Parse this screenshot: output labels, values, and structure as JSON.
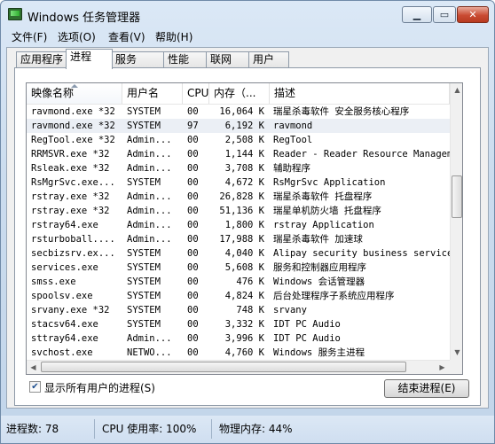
{
  "window": {
    "title": "Windows 任务管理器",
    "minimize_icon": "minimize-icon",
    "maximize_icon": "maximize-icon",
    "close_icon": "close-icon"
  },
  "menu": [
    {
      "label": "文件(F)"
    },
    {
      "label": "选项(O)"
    },
    {
      "label": "查看(V)"
    },
    {
      "label": "帮助(H)"
    }
  ],
  "tabs": [
    {
      "label": "应用程序",
      "active": false
    },
    {
      "label": "进程",
      "active": true
    },
    {
      "label": "服务",
      "active": false
    },
    {
      "label": "性能",
      "active": false
    },
    {
      "label": "联网",
      "active": false
    },
    {
      "label": "用户",
      "active": false
    }
  ],
  "columns": [
    {
      "label": "映像名称",
      "sorted": true
    },
    {
      "label": "用户名",
      "sorted": false
    },
    {
      "label": "CPU",
      "sorted": false
    },
    {
      "label": "内存（...",
      "sorted": false
    },
    {
      "label": "描述",
      "sorted": false
    }
  ],
  "processes": [
    {
      "name": "ravmond.exe *32",
      "user": "SYSTEM",
      "cpu": "00",
      "mem": "16,064 K",
      "desc": "瑞星杀毒软件 安全服务核心程序",
      "selected": false
    },
    {
      "name": "ravmond.exe *32",
      "user": "SYSTEM",
      "cpu": "97",
      "mem": "6,192 K",
      "desc": "ravmond",
      "selected": true
    },
    {
      "name": "RegTool.exe *32",
      "user": "Admin...",
      "cpu": "00",
      "mem": "2,508 K",
      "desc": "RegTool",
      "selected": false
    },
    {
      "name": "RRMSVR.exe *32",
      "user": "Admin...",
      "cpu": "00",
      "mem": "1,144 K",
      "desc": "Reader - Reader Resource Managemer",
      "selected": false
    },
    {
      "name": "Rsleak.exe *32",
      "user": "Admin...",
      "cpu": "00",
      "mem": "3,708 K",
      "desc": "辅助程序",
      "selected": false
    },
    {
      "name": "RsMgrSvc.exe...",
      "user": "SYSTEM",
      "cpu": "00",
      "mem": "4,672 K",
      "desc": "RsMgrSvc Application",
      "selected": false
    },
    {
      "name": "rstray.exe *32",
      "user": "Admin...",
      "cpu": "00",
      "mem": "26,828 K",
      "desc": "瑞星杀毒软件 托盘程序",
      "selected": false
    },
    {
      "name": "rstray.exe *32",
      "user": "Admin...",
      "cpu": "00",
      "mem": "51,136 K",
      "desc": "瑞星单机防火墙 托盘程序",
      "selected": false
    },
    {
      "name": "rstray64.exe",
      "user": "Admin...",
      "cpu": "00",
      "mem": "1,800 K",
      "desc": "rstray Application",
      "selected": false
    },
    {
      "name": "rsturboball....",
      "user": "Admin...",
      "cpu": "00",
      "mem": "17,988 K",
      "desc": "瑞星杀毒软件 加速球",
      "selected": false
    },
    {
      "name": "secbizsrv.ex...",
      "user": "SYSTEM",
      "cpu": "00",
      "mem": "4,040 K",
      "desc": "Alipay security business service",
      "selected": false
    },
    {
      "name": "services.exe",
      "user": "SYSTEM",
      "cpu": "00",
      "mem": "5,608 K",
      "desc": "服务和控制器应用程序",
      "selected": false
    },
    {
      "name": "smss.exe",
      "user": "SYSTEM",
      "cpu": "00",
      "mem": "476 K",
      "desc": "Windows 会话管理器",
      "selected": false
    },
    {
      "name": "spoolsv.exe",
      "user": "SYSTEM",
      "cpu": "00",
      "mem": "4,824 K",
      "desc": "后台处理程序子系统应用程序",
      "selected": false
    },
    {
      "name": "srvany.exe *32",
      "user": "SYSTEM",
      "cpu": "00",
      "mem": "748 K",
      "desc": "srvany",
      "selected": false
    },
    {
      "name": "stacsv64.exe",
      "user": "SYSTEM",
      "cpu": "00",
      "mem": "3,332 K",
      "desc": "IDT PC Audio",
      "selected": false
    },
    {
      "name": "sttray64.exe",
      "user": "Admin...",
      "cpu": "00",
      "mem": "3,996 K",
      "desc": "IDT PC Audio",
      "selected": false
    },
    {
      "name": "svchost.exe",
      "user": "NETWO...",
      "cpu": "00",
      "mem": "4,760 K",
      "desc": "Windows 服务主进程",
      "selected": false
    }
  ],
  "show_all_users": {
    "label": "显示所有用户的进程(S)",
    "checked": true
  },
  "end_process_button": "结束进程(E)",
  "status": {
    "processes": "进程数: 78",
    "cpu": "CPU 使用率: 100%",
    "memory": "物理内存: 44%"
  },
  "colors": {
    "titlebar": "#d3e3f4",
    "selection": "#ebeff5",
    "close_button": "#c94b32"
  }
}
